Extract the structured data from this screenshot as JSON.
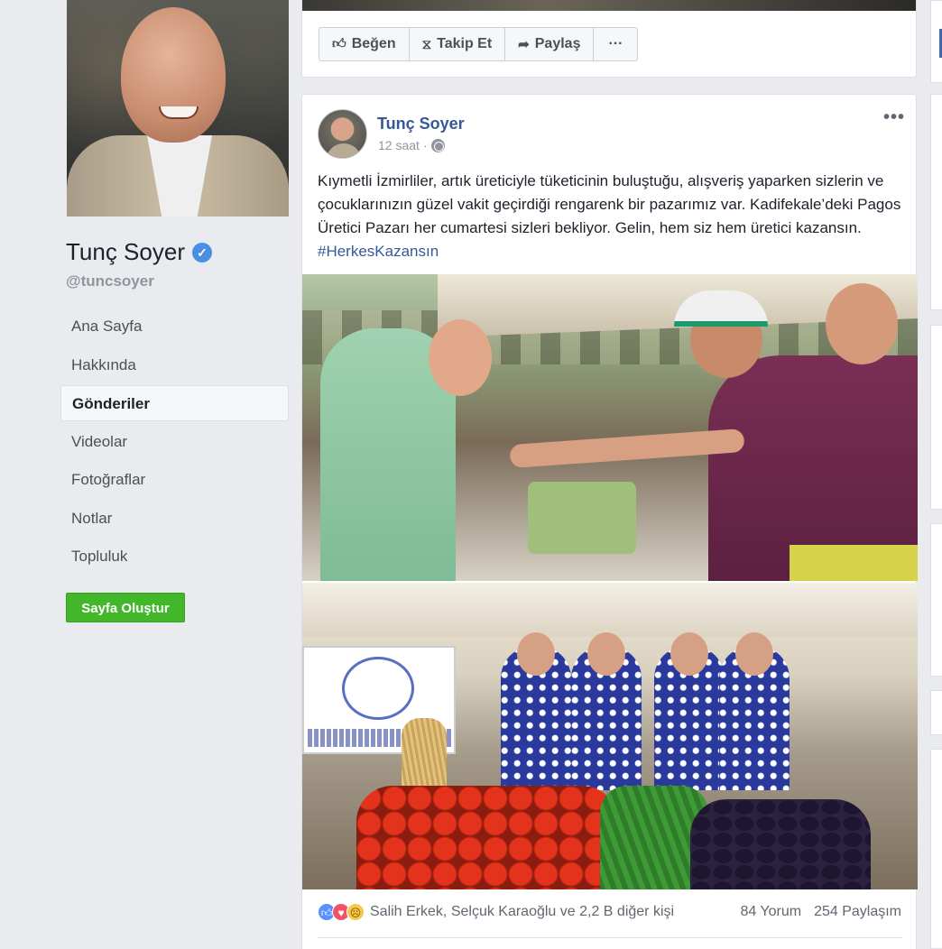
{
  "page": {
    "name": "Tunç Soyer",
    "username": "@tuncsoyer",
    "verified_mark": "✓"
  },
  "sidebar": {
    "items": [
      {
        "label": "Ana Sayfa",
        "active": false
      },
      {
        "label": "Hakkında",
        "active": false
      },
      {
        "label": "Gönderiler",
        "active": true
      },
      {
        "label": "Videolar",
        "active": false
      },
      {
        "label": "Fotoğraflar",
        "active": false
      },
      {
        "label": "Notlar",
        "active": false
      },
      {
        "label": "Topluluk",
        "active": false
      }
    ],
    "create_page_label": "Sayfa Oluştur"
  },
  "actions": {
    "like": "Beğen",
    "follow": "Takip Et",
    "share": "Paylaş",
    "more": "···"
  },
  "post": {
    "author": "Tunç Soyer",
    "time": "12 saat",
    "separator": "·",
    "more": "•••",
    "text": "Kıymetli İzmirliler, artık üreticiyle tüketicinin buluştuğu, alışveriş yaparken sizlerin ve çocuklarınızın güzel vakit geçirdiği rengarenk bir pazarımız var. Kadifekale’deki Pagos Üretici Pazarı her cumartesi sizleri bekliyor. Gelin, hem siz hem üretici kazansın.",
    "hashtag": "#HerkesKazansın",
    "reactions_text": "Salih Erkek, Selçuk Karaoğlu ve 2,2 B diğer kişi",
    "comments": "84 Yorum",
    "shares": "254 Paylaşım"
  },
  "icons": {
    "like": "thumbs-up-icon",
    "follow": "rss-icon",
    "share": "share-arrow-icon",
    "privacy": "globe-icon"
  },
  "colors": {
    "link_blue": "#365899",
    "create_green": "#42b72a",
    "verified_blue": "#4a90e2"
  }
}
